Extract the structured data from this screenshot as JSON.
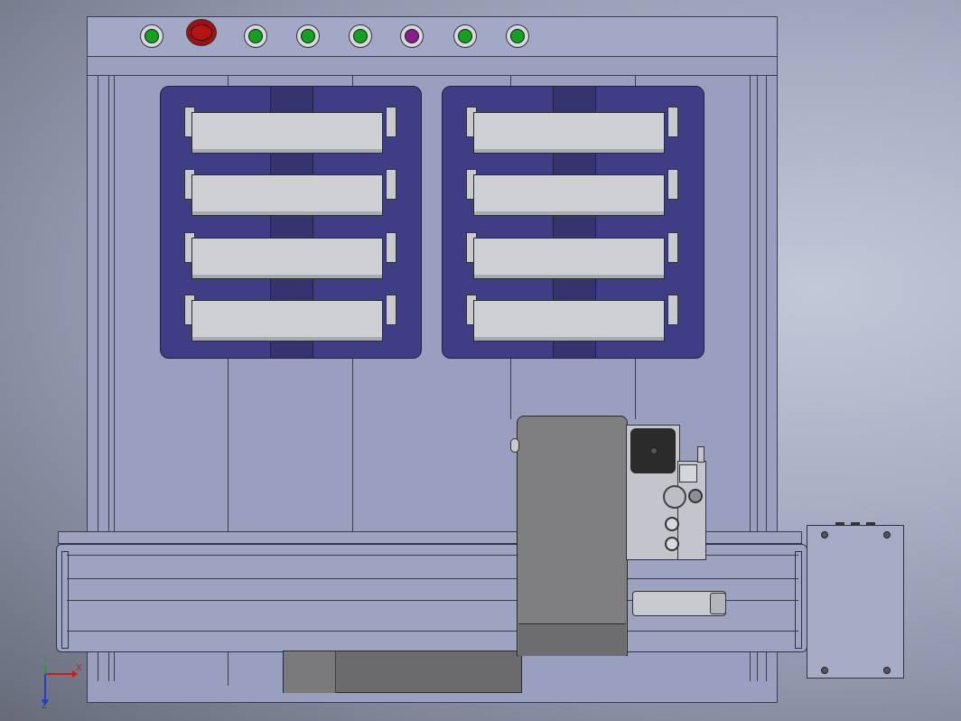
{
  "viewport": {
    "background_colors": [
      "#c3c8d8",
      "#676b79"
    ]
  },
  "control_panel": {
    "buttons": [
      {
        "name": "indicator-green-1",
        "color": "#12a21f"
      },
      {
        "name": "emergency-stop",
        "color": "#a10f0f"
      },
      {
        "name": "indicator-green-2",
        "color": "#12a21f"
      },
      {
        "name": "indicator-green-3",
        "color": "#12a21f"
      },
      {
        "name": "indicator-green-4",
        "color": "#12a21f"
      },
      {
        "name": "indicator-purple",
        "color": "#8a1b8f"
      },
      {
        "name": "indicator-green-5",
        "color": "#12a21f"
      },
      {
        "name": "indicator-green-6",
        "color": "#12a21f"
      }
    ]
  },
  "trays": {
    "count": 2,
    "drawers_per_tray": 4,
    "tray_color": "#3f3d86",
    "drawer_color": "#cfd0d4"
  },
  "axis_triad": {
    "x_label": "X",
    "y_label": "Y",
    "z_label": "Z",
    "x_color": "#d11a1a",
    "y_color": "#18a33a",
    "z_color": "#1b3fd1"
  }
}
